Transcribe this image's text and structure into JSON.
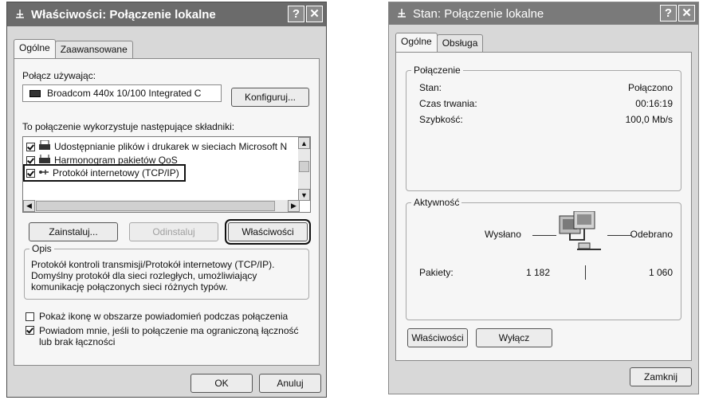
{
  "left_dialog": {
    "title": "Właściwości: Połączenie lokalne",
    "help_btn": "?",
    "close_btn": "✕",
    "tabs": [
      "Ogólne",
      "Zaawansowane"
    ],
    "connect_using_label": "Połącz używając:",
    "adapter_name": "Broadcom 440x 10/100 Integrated C",
    "configure_btn": "Konfiguruj...",
    "components_label": "To połączenie wykorzystuje następujące składniki:",
    "components": [
      {
        "label": "Udostępnianie plików i drukarek w sieciach Microsoft N",
        "checked": true,
        "icon": "printer-icon"
      },
      {
        "label": "Harmonogram pakietów QoS",
        "checked": true,
        "icon": "printer-icon"
      },
      {
        "label": "Protokół internetowy (TCP/IP)",
        "checked": true,
        "icon": "network-protocol-icon"
      }
    ],
    "install_btn": "Zainstaluj...",
    "uninstall_btn": "Odinstaluj",
    "properties_btn": "Właściwości",
    "description_group": "Opis",
    "description_text": "Protokół kontroli transmisji/Protokół internetowy (TCP/IP). Domyślny protokół dla sieci rozległych, umożliwiający komunikację połączonych sieci różnych typów.",
    "show_icon_label": "Pokaż ikonę w obszarze powiadomień podczas połączenia",
    "show_icon_checked": false,
    "notify_label": "Powiadom mnie, jeśli to połączenie ma ograniczoną łączność lub brak łączności",
    "notify_checked": true,
    "ok_btn": "OK",
    "cancel_btn": "Anuluj"
  },
  "right_dialog": {
    "title": "Stan: Połączenie lokalne",
    "help_btn": "?",
    "close_btn": "✕",
    "tabs": [
      "Ogólne",
      "Obsługa"
    ],
    "connection_group": "Połączenie",
    "status_label": "Stan:",
    "status_value": "Połączono",
    "duration_label": "Czas trwania:",
    "duration_value": "00:16:19",
    "speed_label": "Szybkość:",
    "speed_value": "100,0 Mb/s",
    "activity_group": "Aktywność",
    "sent_label": "Wysłano",
    "received_label": "Odebrano",
    "packets_label": "Pakiety:",
    "packets_sent": "1 182",
    "packets_received": "1 060",
    "properties_btn": "Właściwości",
    "disable_btn": "Wyłącz",
    "close_dialog_btn": "Zamknij"
  }
}
